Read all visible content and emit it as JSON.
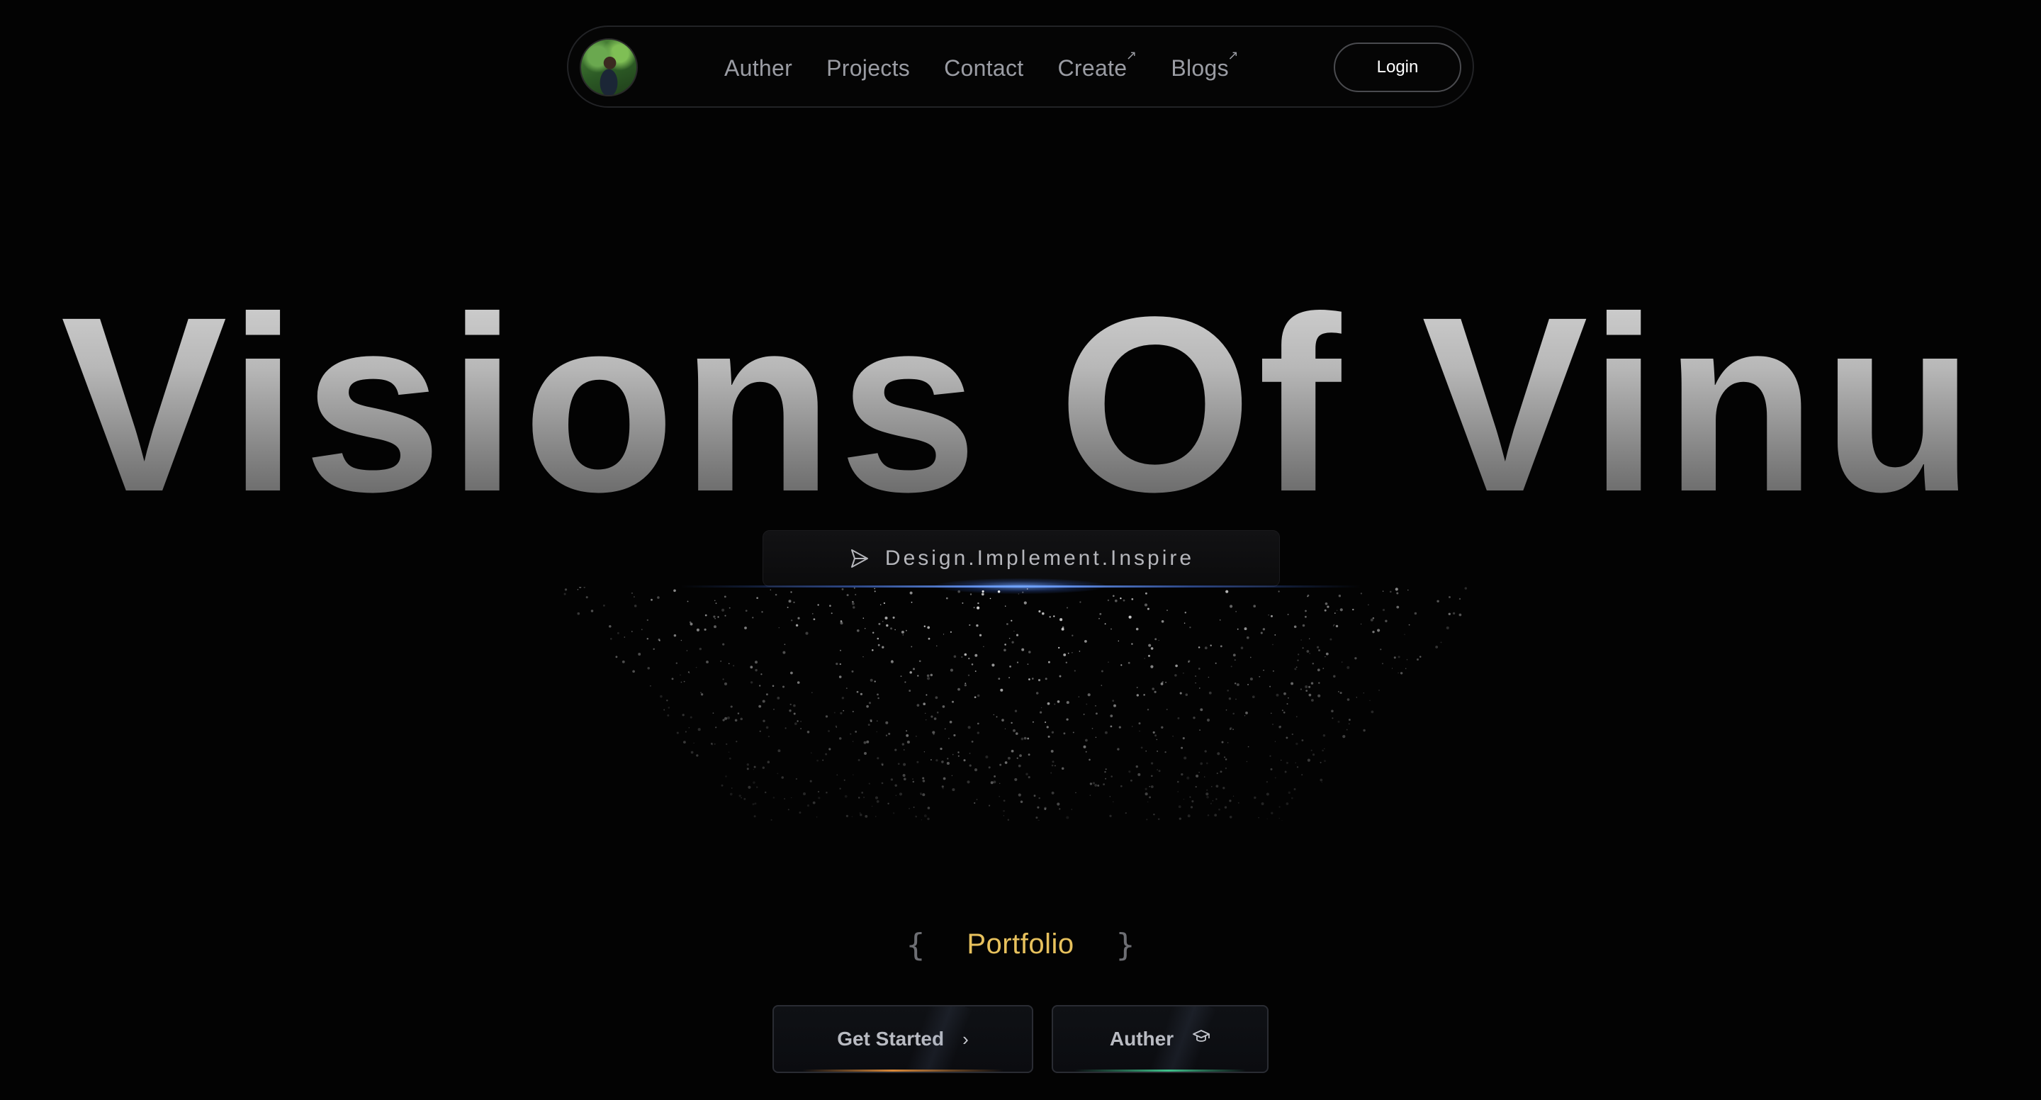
{
  "nav": {
    "avatar_alt": "profile photo",
    "links": [
      {
        "label": "Auther",
        "external": false
      },
      {
        "label": "Projects",
        "external": false
      },
      {
        "label": "Contact",
        "external": false
      },
      {
        "label": "Create",
        "external": true
      },
      {
        "label": "Blogs",
        "external": true
      }
    ],
    "external_icon": "↗",
    "login_label": "Login"
  },
  "hero": {
    "title": "Visions Of Vinu",
    "tagline": "Design.Implement.Inspire",
    "tagline_icon": "send-icon"
  },
  "portfolio": {
    "brace_left": "{",
    "label": "Portfolio",
    "brace_right": "}"
  },
  "cta": {
    "get_started_label": "Get Started",
    "get_started_icon": "›",
    "auther_label": "Auther",
    "auther_icon": "graduation-cap-icon"
  },
  "colors": {
    "background": "#030303",
    "accent_gold": "#e7c15d",
    "glow_blue": "#6fa2ff",
    "underline_orange": "#d9893a",
    "underline_green": "#3fc08a"
  }
}
